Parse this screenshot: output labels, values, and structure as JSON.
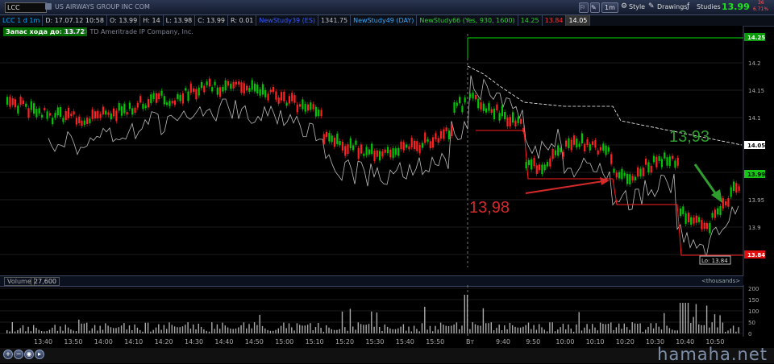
{
  "toolbar": {
    "symbol": "LCC",
    "company": "US AIRWAYS GROUP INC COM",
    "interval": "1m",
    "style": "Style",
    "drawings": "Drawings",
    "studies": "Studies",
    "last_price": "13.99",
    "mini_top": "36",
    "mini_bottom": "6.71%"
  },
  "header": {
    "cells": [
      "LCC 1 d 1m",
      "D: 17.07.12 10:58",
      "O: 13.99",
      "H: 14",
      "L: 13.98",
      "C: 13.99",
      "R: 0.01",
      "NewStudy39 (ES)",
      "1341.75",
      "NewStudy49 (DAY)",
      "NewStudy66 (Yes, 930, 1600)",
      "14.25",
      "13.84",
      "14.05"
    ]
  },
  "chart_labels": {
    "reserve": "Запас хода до: 13.72",
    "copyright": "2012 © TD Ameritrade IP Company, Inc.",
    "annotation_red": "13,98",
    "annotation_green": "13,93",
    "lo_label": "Lo: 13.84",
    "day_separator": "Вт"
  },
  "price_axis": {
    "ticks": [
      "14.2",
      "14.15",
      "14.1",
      "14.05",
      "14",
      "13.95",
      "13.9",
      "13.85"
    ],
    "box_high": "14.25",
    "box_prev": "14.05",
    "box_last": "13.99",
    "box_low": "13.84"
  },
  "volume": {
    "label": "Volume",
    "value": "27,600",
    "units": "<thousands>",
    "ticks": [
      "200",
      "150",
      "100",
      "50",
      "0"
    ]
  },
  "time_axis": [
    "13:40",
    "13:50",
    "14:00",
    "14:10",
    "14:20",
    "14:30",
    "14:40",
    "14:50",
    "15:00",
    "15:10",
    "15:20",
    "15:30",
    "15:40",
    "15:50",
    "Вт",
    "9:40",
    "9:50",
    "10:00",
    "10:10",
    "10:20",
    "10:30",
    "10:40",
    "10:50"
  ],
  "watermark": "hamaha.net",
  "colors": {
    "up": "#00c800",
    "down": "#ff2020",
    "ref_line": "#bbbbbb",
    "high_line": "#00b000",
    "annotation_red": "#d42a2a",
    "annotation_green": "#2f9e2f"
  }
}
